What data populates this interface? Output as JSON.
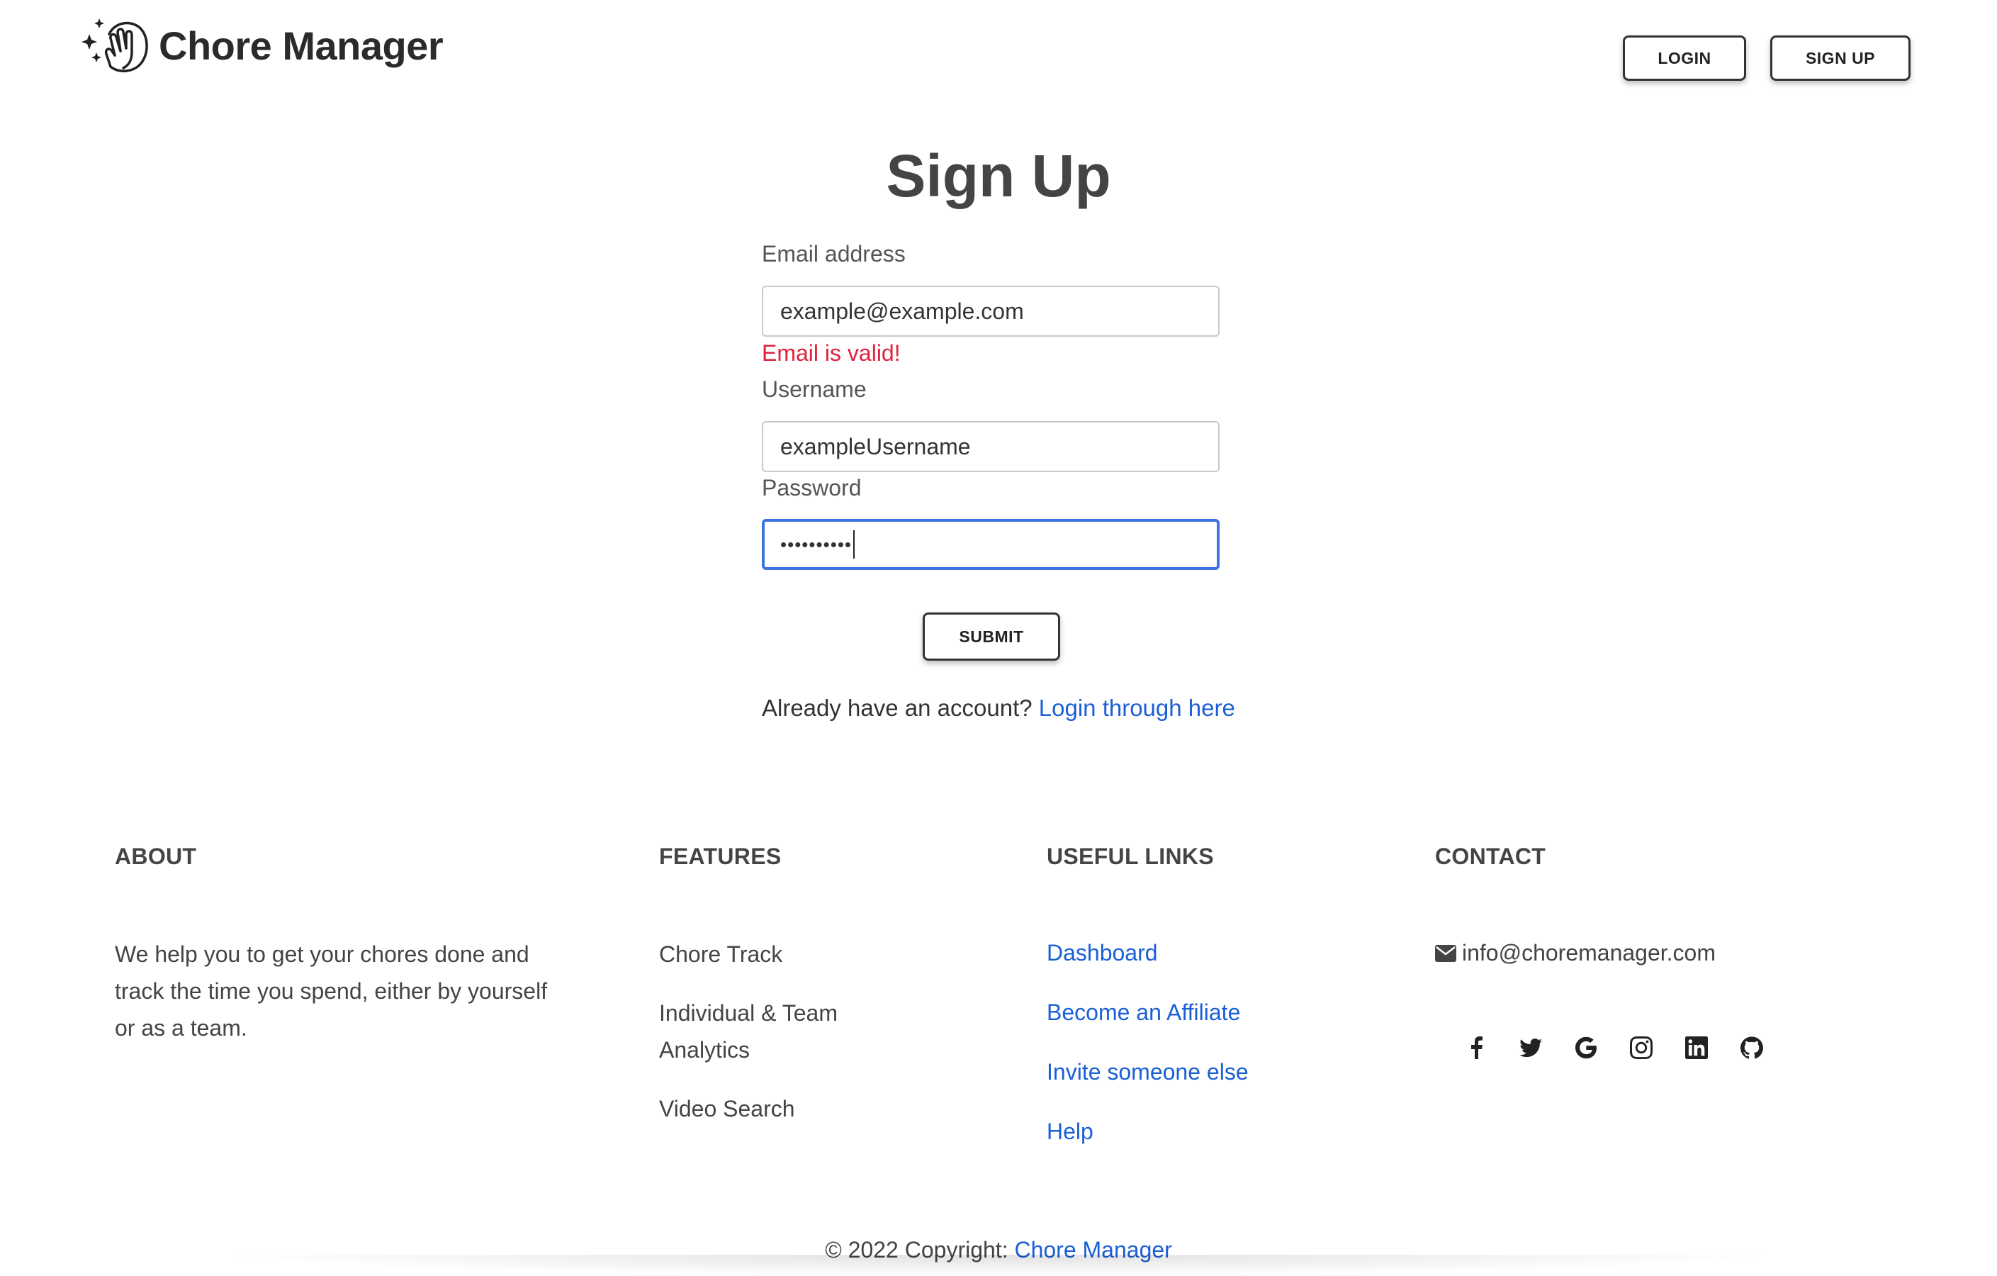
{
  "header": {
    "brand_name": "Chore Manager",
    "login_label": "LOGIN",
    "signup_label": "SIGN UP"
  },
  "form": {
    "title": "Sign Up",
    "email_label": "Email address",
    "email_value": "example@example.com",
    "email_valid_msg": "Email is valid!",
    "username_label": "Username",
    "username_value": "exampleUsername",
    "password_label": "Password",
    "password_masked": "••••••••••",
    "submit_label": "SUBMIT",
    "already_text": "Already have an account?",
    "login_link": "Login through here"
  },
  "footer": {
    "about": {
      "heading": "ABOUT",
      "text": "We help you to get your chores done and track the time you spend, either by yourself or as a team."
    },
    "features": {
      "heading": "FEATURES",
      "items": [
        "Chore Track",
        "Individual & Team Analytics",
        "Video Search"
      ]
    },
    "useful_links": {
      "heading": "USEFUL LINKS",
      "items": [
        "Dashboard",
        "Become an Affiliate",
        "Invite someone else",
        "Help"
      ]
    },
    "contact": {
      "heading": "CONTACT",
      "email": "info@choremanager.com",
      "social_icons": [
        "facebook-icon",
        "twitter-icon",
        "google-icon",
        "instagram-icon",
        "linkedin-icon",
        "github-icon"
      ]
    },
    "copyright_prefix": "© 2022 Copyright:",
    "copyright_link": "Chore Manager"
  },
  "colors": {
    "link": "#1a5fd6",
    "error_text": "#e0223d",
    "focus_border": "#3d72e0"
  }
}
